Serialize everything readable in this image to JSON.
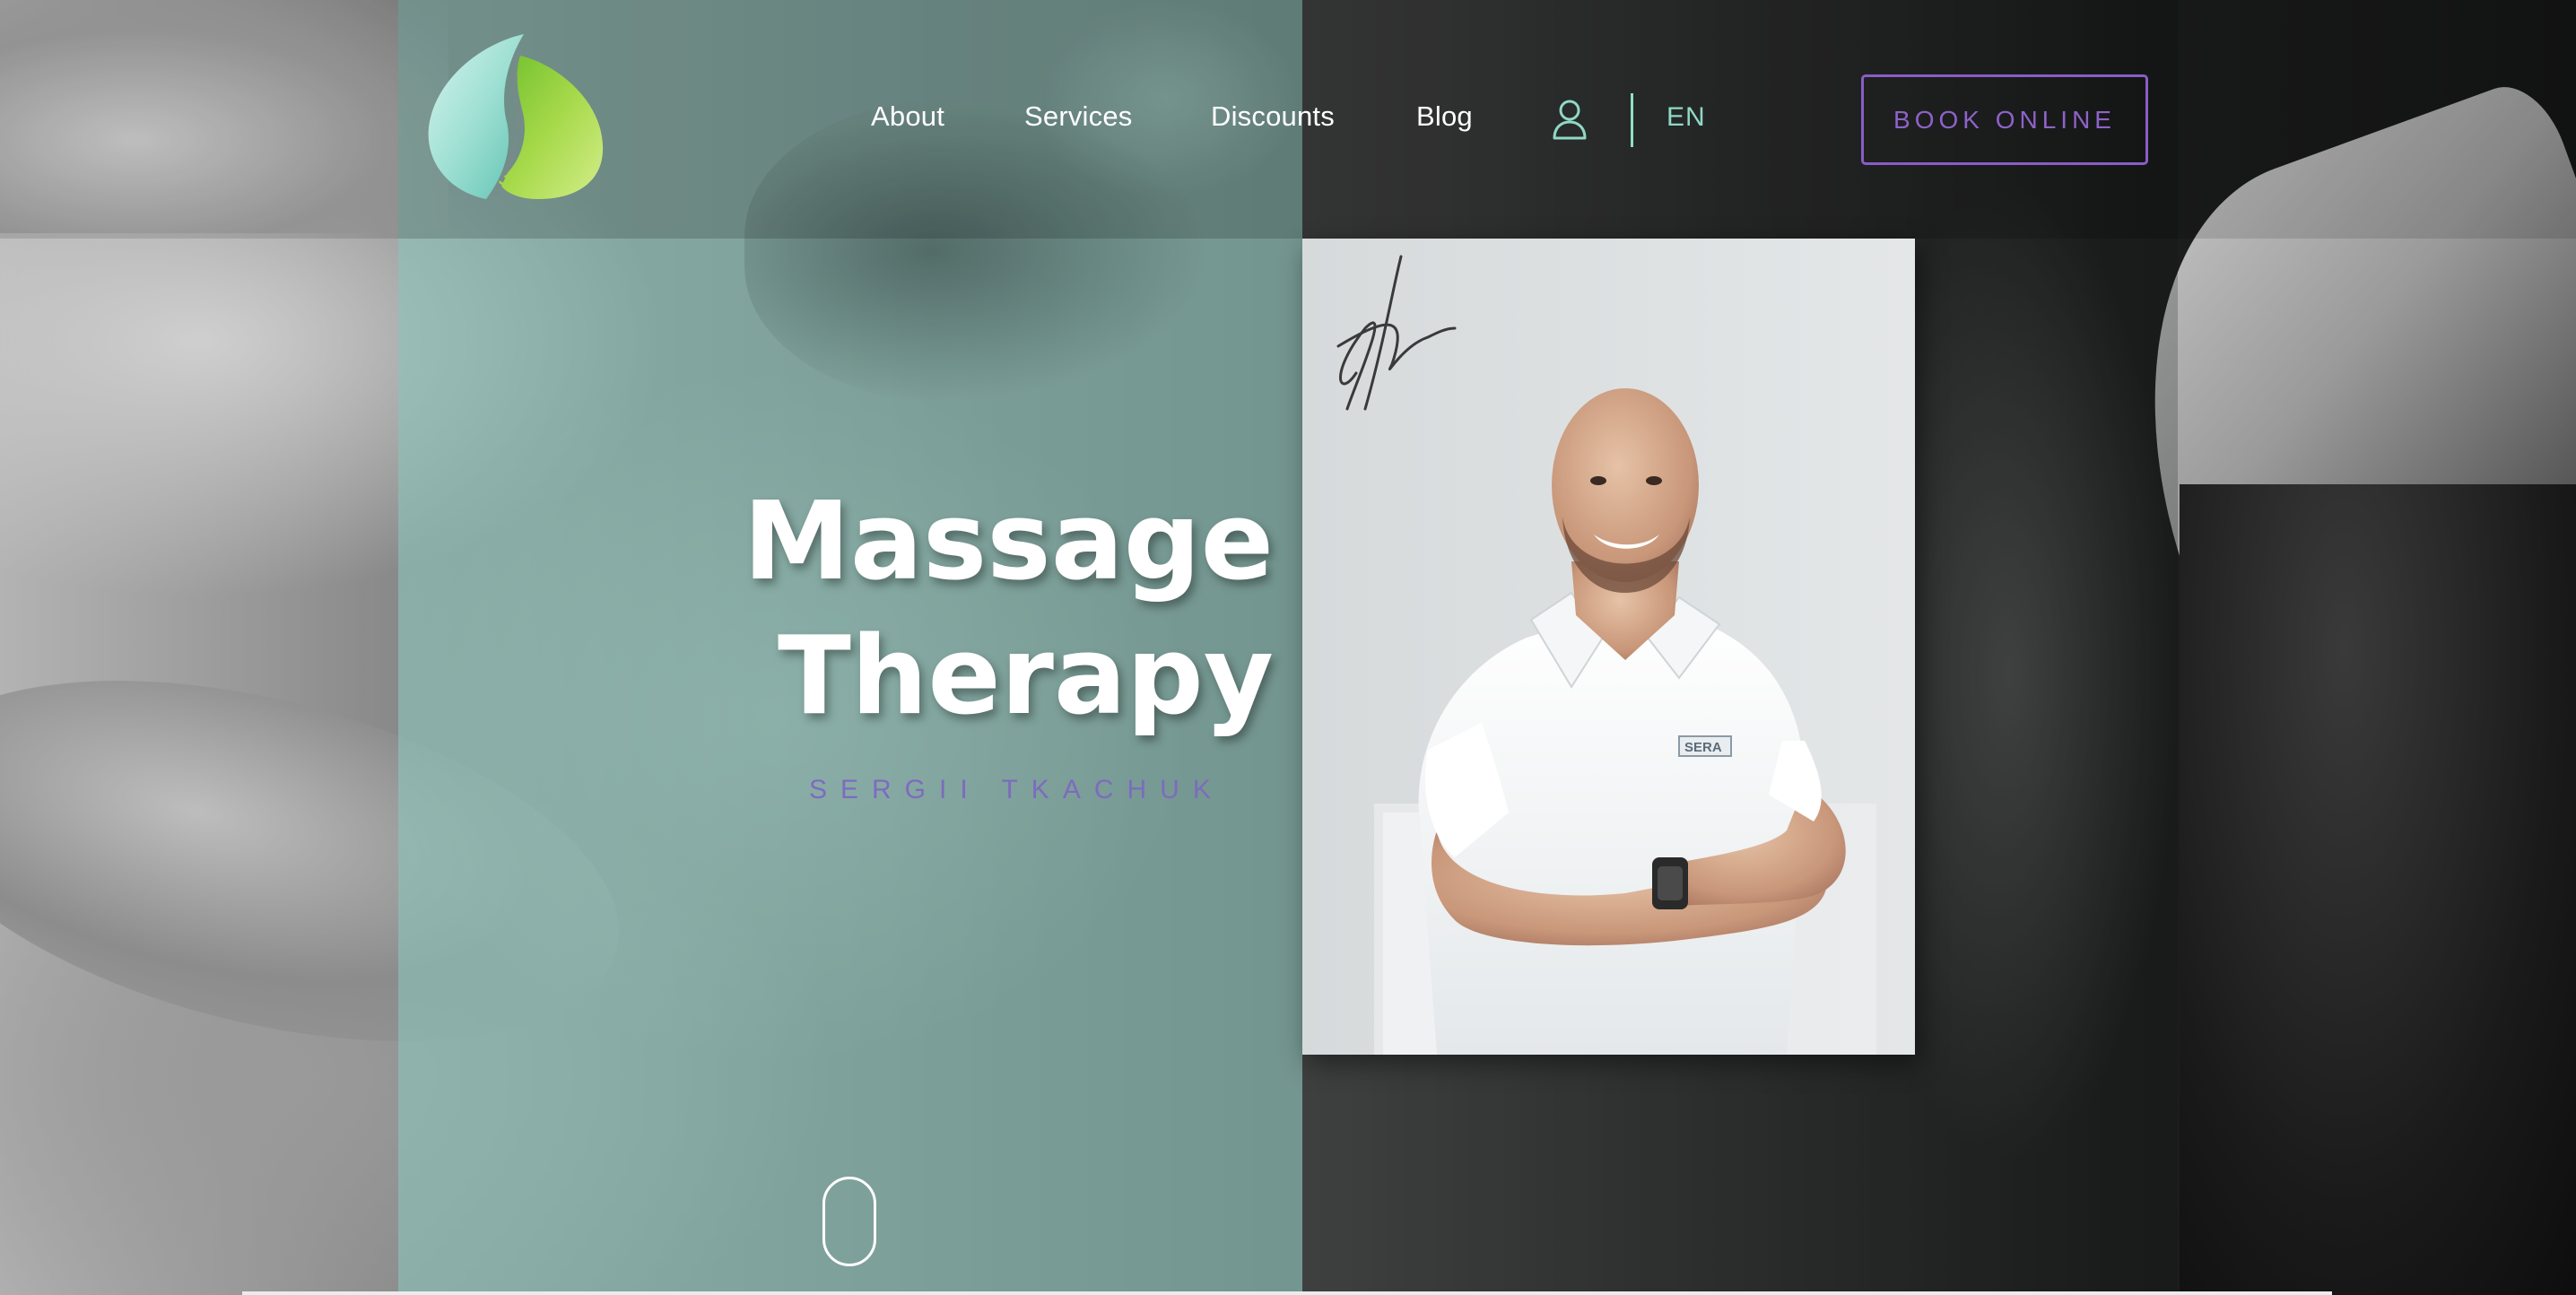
{
  "nav": {
    "items": [
      {
        "label": "About"
      },
      {
        "label": "Services"
      },
      {
        "label": "Discounts"
      },
      {
        "label": "Blog"
      }
    ],
    "language": "EN",
    "book_button": "BOOK ONLINE"
  },
  "hero": {
    "title": "Massage\nTherapy",
    "subtitle": "SERGII TKACHUK",
    "badge_text": "SERA"
  },
  "icons": {
    "account": "user-icon",
    "logo": "spine-leaf-logo",
    "scroll": "scroll-indicator-icon"
  },
  "colors": {
    "accent_purple": "#8a5cc7",
    "accent_teal": "#8fd9c5",
    "panel_teal": "#8cc4ba",
    "logo_green": "#8cc63f"
  }
}
